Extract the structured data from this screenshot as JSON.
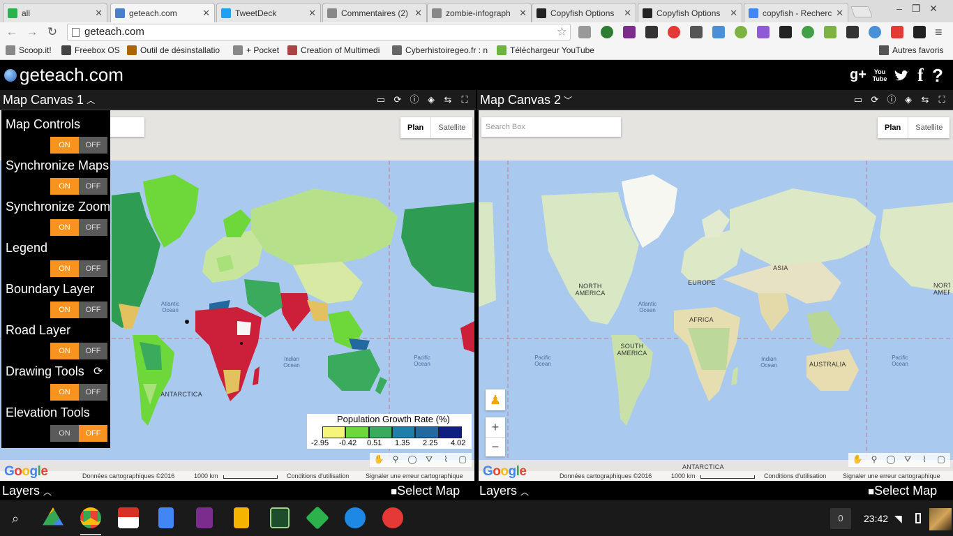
{
  "browser": {
    "tabs": [
      {
        "title": "all",
        "icon": "feedly-icon",
        "color": "#2bb24c"
      },
      {
        "title": "geteach.com",
        "icon": "globe-icon",
        "color": "#4a7fc9"
      },
      {
        "title": "TweetDeck",
        "icon": "tweetdeck-icon",
        "color": "#1da1f2"
      },
      {
        "title": "Commentaires (2)",
        "icon": "document-icon",
        "color": "#888888"
      },
      {
        "title": "zombie-infograph",
        "icon": "document-icon",
        "color": "#888888"
      },
      {
        "title": "Copyfish Options",
        "icon": "fish-icon",
        "color": "#222222"
      },
      {
        "title": "Copyfish Options",
        "icon": "fish-icon",
        "color": "#222222"
      },
      {
        "title": "copyfish - Recherc",
        "icon": "google-icon",
        "color": "#4285f4"
      }
    ],
    "url": "geteach.com",
    "bookmarks": [
      {
        "label": "Scoop.it!",
        "color": "#888888"
      },
      {
        "label": "Freebox OS",
        "color": "#444444"
      },
      {
        "label": "Outil de désinstallatio",
        "color": "#aa6600"
      },
      {
        "label": "+ Pocket",
        "color": "#888888"
      },
      {
        "label": "Creation of Multimedi",
        "color": "#aa4444"
      },
      {
        "label": "Cyberhistoiregeo.fr : n",
        "color": "#666666"
      },
      {
        "label": "Téléchargeur YouTube",
        "color": "#6db33f"
      }
    ],
    "other_bookmarks": "Autres favoris"
  },
  "app": {
    "logo": "geteach.com",
    "social": [
      "g+",
      "You Tube",
      "twitter",
      "f",
      "?"
    ]
  },
  "canvas1": {
    "title": "Map Canvas 1",
    "footer_left": "Layers",
    "footer_right": "Select Map",
    "plan": "Plan",
    "satellite": "Satellite",
    "attribution": "Données cartographiques ©2016",
    "scale": "1000 km",
    "terms": "Conditions d'utilisation",
    "report": "Signaler une erreur cartographique",
    "labels": {
      "antarctica": "ANTARCTICA",
      "atlantic": "Atlantic Ocean",
      "indian": "Indian Ocean",
      "pacific": "Pacific Ocean"
    }
  },
  "canvas2": {
    "title": "Map Canvas 2",
    "footer_left": "Layers",
    "footer_right": "Select Map",
    "search_placeholder": "Search Box",
    "plan": "Plan",
    "satellite": "Satellite",
    "attribution": "Données cartographiques ©2016",
    "scale": "1000 km",
    "terms": "Conditions d'utilisation",
    "report": "Signaler une erreur cartographique",
    "labels": {
      "north_america": "NORTH AMERICA",
      "south_america": "SOUTH AMERICA",
      "europe": "EUROPE",
      "asia": "ASIA",
      "africa": "AFRICA",
      "australia": "AUSTRALIA",
      "antarctica": "ANTARCTICA",
      "atlantic": "Atlantic Ocean",
      "indian": "Indian Ocean",
      "pacific_left": "Pacific Ocean",
      "pacific_right": "Pacific Ocean",
      "north_right": "NORT AMERI"
    }
  },
  "controls": [
    {
      "label": "Map Controls",
      "state": "on"
    },
    {
      "label": "Synchronize Maps",
      "state": "on"
    },
    {
      "label": "Synchronize Zoom",
      "state": "on"
    },
    {
      "label": "Legend",
      "state": "on"
    },
    {
      "label": "Boundary Layer",
      "state": "on"
    },
    {
      "label": "Road Layer",
      "state": "on"
    },
    {
      "label": "Drawing Tools",
      "state": "on"
    },
    {
      "label": "Elevation Tools",
      "state": "off"
    }
  ],
  "toggle_on": "ON",
  "toggle_off": "OFF",
  "legend": {
    "title": "Population Growth Rate (%)",
    "ticks": [
      "-2.95",
      "-0.42",
      "0.51",
      "1.35",
      "2.25",
      "4.02"
    ],
    "colors": [
      "#f5f57a",
      "#6ed83a",
      "#3aaa5c",
      "#1f7fa8",
      "#23689e",
      "#0f1f80"
    ]
  },
  "taskbar": {
    "tray_count": "0",
    "time": "23:42"
  }
}
